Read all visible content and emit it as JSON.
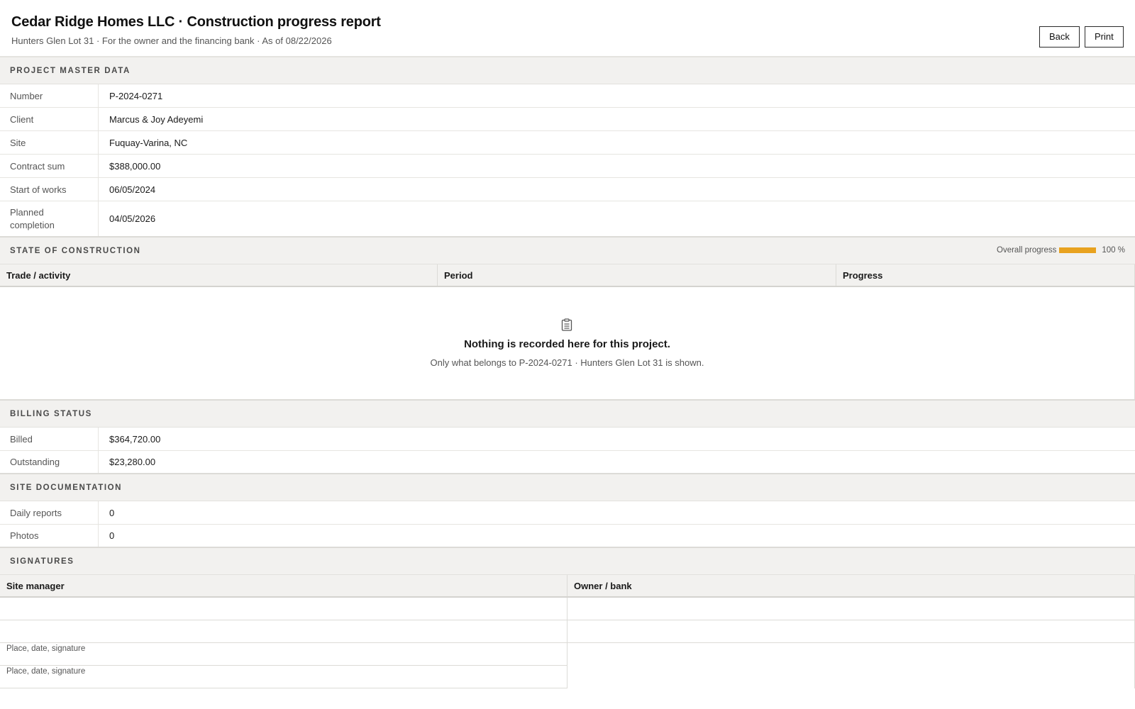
{
  "header": {
    "title": "Cedar Ridge Homes LLC · Construction progress report",
    "subtitle": "Hunters Glen Lot 31 · For the owner and the financing bank · As of 08/22/2026",
    "back_label": "Back",
    "print_label": "Print"
  },
  "master": {
    "title": "Project master data",
    "rows": [
      {
        "label": "Number",
        "value": "P-2024-0271"
      },
      {
        "label": "Client",
        "value": "Marcus & Joy Adeyemi"
      },
      {
        "label": "Site",
        "value": "Fuquay-Varina, NC"
      },
      {
        "label": "Contract sum",
        "value": "$388,000.00"
      },
      {
        "label": "Start of works",
        "value": "06/05/2024"
      },
      {
        "label": "Planned completion",
        "value": "04/05/2026"
      }
    ]
  },
  "construction": {
    "title": "State of construction",
    "overall_label": "Overall progress",
    "overall_value": "100 %",
    "overall_fraction": 1.0,
    "progress_color": "#e8a21f",
    "columns": [
      "Trade / activity",
      "Period",
      "Progress"
    ],
    "empty_icon": "clipboard-icon",
    "empty_message": "Nothing is recorded here for this project.",
    "empty_sub": "Only what belongs to P-2024-0271 · Hunters Glen Lot 31 is shown."
  },
  "billing": {
    "title": "Billing status",
    "rows": [
      {
        "label": "Billed",
        "value": "$364,720.00"
      },
      {
        "label": "Outstanding",
        "value": "$23,280.00"
      }
    ]
  },
  "documentation": {
    "title": "Site documentation",
    "rows": [
      {
        "label": "Daily reports",
        "value": "0"
      },
      {
        "label": "Photos",
        "value": "0"
      }
    ]
  },
  "signatures": {
    "title": "Signatures",
    "columns": [
      "Site manager",
      "Owner / bank"
    ],
    "caption": "Place, date, signature"
  }
}
